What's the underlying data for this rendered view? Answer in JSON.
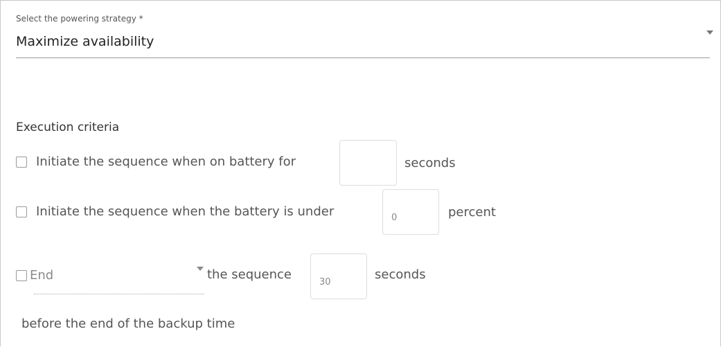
{
  "strategy": {
    "label": "Select the powering strategy *",
    "value": "Maximize availability"
  },
  "execution": {
    "title": "Execution criteria",
    "battery_time": {
      "label": "Initiate the sequence when on battery for",
      "value": "",
      "unit": "seconds",
      "checked": false
    },
    "battery_level": {
      "label": "Initiate the sequence when the battery is under",
      "value": "0",
      "unit": "percent",
      "checked": false
    },
    "end_sequence": {
      "select_value": "End",
      "middle_text": "the sequence",
      "value": "30",
      "unit": "seconds",
      "trailing_text": "before the end of the backup time",
      "checked": false
    }
  }
}
